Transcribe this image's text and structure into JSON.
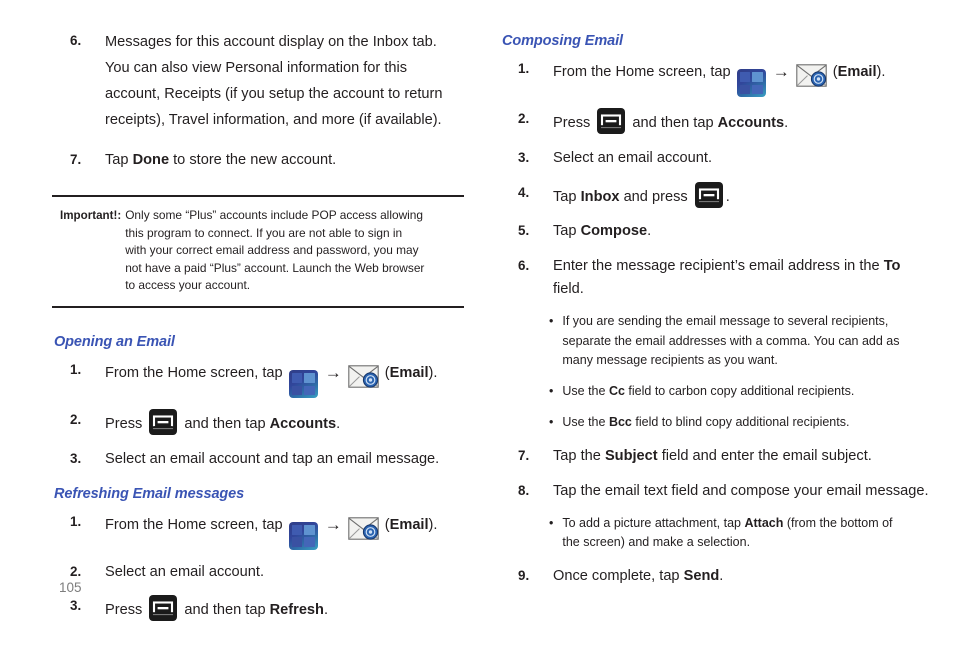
{
  "page": {
    "number": "105"
  },
  "icons": {
    "apps": "apps-grid-icon",
    "arrow": "→",
    "email": "email-envelope-icon",
    "menu": "menu-key-icon",
    "bullet": "•"
  },
  "colors": {
    "heading": "#3a54b4",
    "body_text": "#231f20",
    "page_number": "#7d7d7d",
    "rule": "#231f20"
  },
  "left_column": {
    "continued_steps": [
      {
        "num": "6.",
        "text": "Messages for this account display on the Inbox tab. You can also view Personal information for this account, Receipts (if you setup the account to return receipts), Travel information, and more (if available)."
      },
      {
        "num": "7.",
        "pre": "Tap ",
        "bold": "Done",
        "post": " to store the new account."
      }
    ],
    "note": {
      "label": "Important!:",
      "text": "Only some “Plus” accounts include POP access allowing this program to connect. If you are not able to sign in with your correct email address and password, you may not have a paid “Plus” account. Launch the Web browser to access your account."
    },
    "sections": [
      {
        "heading": "Opening an Email",
        "steps": [
          {
            "num": "1.",
            "pre": "From the Home screen, tap ",
            "post": " (",
            "bold": "Email",
            "tail": ")."
          },
          {
            "num": "2.",
            "pre": "Press ",
            "mid": " and then tap ",
            "bold": "Accounts",
            "tail": "."
          },
          {
            "num": "3.",
            "text": "Select an email account and tap an email message."
          }
        ]
      },
      {
        "heading": "Refreshing Email messages",
        "steps": [
          {
            "num": "1.",
            "pre": "From the Home screen, tap ",
            "post": " (",
            "bold": "Email",
            "tail": ")."
          },
          {
            "num": "2.",
            "text": "Select an email account."
          },
          {
            "num": "3.",
            "pre": "Press ",
            "mid": " and then tap ",
            "bold": "Refresh",
            "tail": "."
          }
        ]
      }
    ]
  },
  "right_column": {
    "heading": "Composing Email",
    "steps": [
      {
        "num": "1.",
        "pre": "From the Home screen, tap ",
        "post": " (",
        "bold": "Email",
        "tail": ")."
      },
      {
        "num": "2.",
        "pre": "Press ",
        "mid": " and then tap ",
        "bold": "Accounts",
        "tail": "."
      },
      {
        "num": "3.",
        "text": "Select an email account."
      },
      {
        "num": "4.",
        "pre": "Tap ",
        "bold": "Inbox",
        "mid": " and press ",
        "tail": "."
      },
      {
        "num": "5.",
        "pre": "Tap ",
        "bold": "Compose",
        "tail": "."
      },
      {
        "num": "6.",
        "pre": "Enter the message recipient’s email address in the ",
        "bold": "To",
        "tail": " field."
      }
    ],
    "bullets_after_6": [
      {
        "text": "If you are sending the email message to several recipients, separate the email addresses with a comma. You can add as many message recipients as you want."
      },
      {
        "pre": "Use the ",
        "bold": "Cc",
        "post": " field to carbon copy additional recipients."
      },
      {
        "pre": "Use the ",
        "bold": "Bcc",
        "post": " field to blind copy additional recipients."
      }
    ],
    "steps_7_8": [
      {
        "num": "7.",
        "pre": "Tap the ",
        "bold": "Subject",
        "tail": " field and enter the email subject."
      },
      {
        "num": "8.",
        "text": "Tap the email text field and compose your email message."
      }
    ],
    "bullets_after_8": [
      {
        "pre": "To add a picture attachment, tap ",
        "bold": "Attach",
        "post": " (from the bottom of the screen) and make a selection."
      }
    ],
    "step_9": {
      "num": "9.",
      "pre": "Once complete, tap ",
      "bold": "Send",
      "tail": "."
    }
  }
}
